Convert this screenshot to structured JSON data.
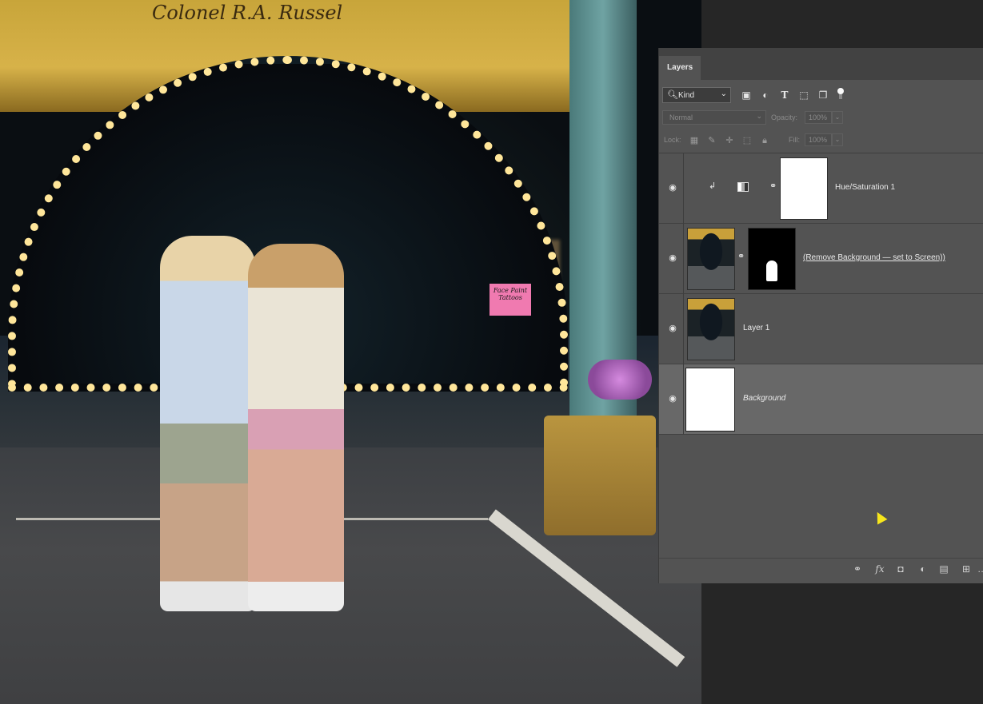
{
  "panel": {
    "tab_label": "Layers",
    "filter": {
      "kind_label": "Kind",
      "icons": [
        "image-filter-icon",
        "adjustment-filter-icon",
        "type-filter-icon",
        "shape-filter-icon",
        "smart-object-filter-icon"
      ]
    },
    "blend_mode": "Normal",
    "opacity_label": "Opacity:",
    "opacity_value": "100%",
    "lock_label": "Lock:",
    "fill_label": "Fill:",
    "fill_value": "100%"
  },
  "layers": [
    {
      "name": "Hue/Saturation 1",
      "type": "adjustment",
      "visible": true,
      "clipped": true
    },
    {
      "name": "(Remove Background — set to Screen))",
      "type": "smart-object-with-mask",
      "visible": true
    },
    {
      "name": "Layer 1",
      "type": "pixel",
      "visible": true
    },
    {
      "name": "Background",
      "type": "background",
      "visible": true,
      "selected": true,
      "locked": true
    }
  ],
  "footer_icons": [
    "link-layers-icon",
    "fx-icon",
    "add-mask-icon",
    "new-adjustment-icon",
    "new-group-icon",
    "new-layer-icon",
    "delete-layer-icon"
  ],
  "canvas": {
    "sign_text": "Colonel R.A. Russel",
    "booth_sign_text": "Face Paint Tattoos"
  },
  "colors": {
    "panel_bg": "#535353",
    "tab_bar_bg": "#424242",
    "selected_row": "#686868",
    "cursor": "#f7e61c"
  }
}
